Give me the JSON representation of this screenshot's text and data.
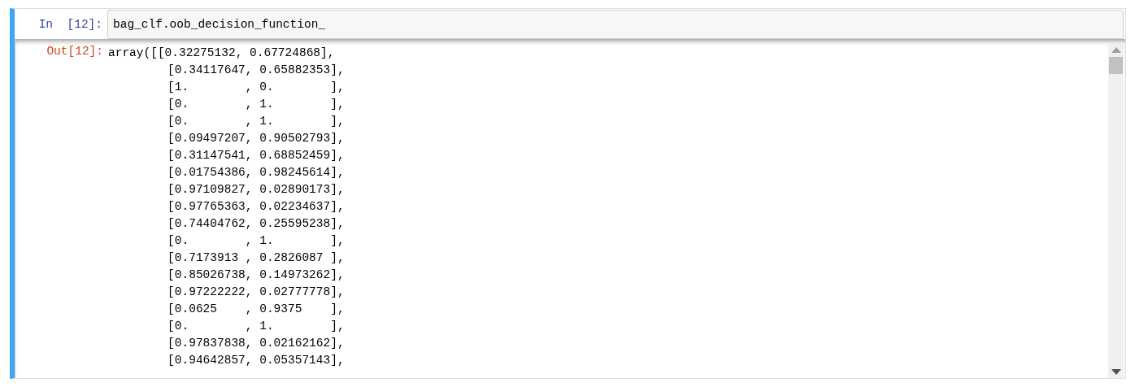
{
  "input_cell": {
    "prompt": "In  [12]:",
    "code": "bag_clf.oob_decision_function_"
  },
  "output_cell": {
    "prompt": "Out[12]:",
    "lines": [
      "array([[0.32275132, 0.67724868],",
      "[0.34117647, 0.65882353],",
      "[1.        , 0.        ],",
      "[0.        , 1.        ],",
      "[0.        , 1.        ],",
      "[0.09497207, 0.90502793],",
      "[0.31147541, 0.68852459],",
      "[0.01754386, 0.98245614],",
      "[0.97109827, 0.02890173],",
      "[0.97765363, 0.02234637],",
      "[0.74404762, 0.25595238],",
      "[0.        , 1.        ],",
      "[0.7173913 , 0.2826087 ],",
      "[0.85026738, 0.14973262],",
      "[0.97222222, 0.02777778],",
      "[0.0625    , 0.9375    ],",
      "[0.        , 1.        ],",
      "[0.97837838, 0.02162162],",
      "[0.94642857, 0.05357143],"
    ]
  }
}
